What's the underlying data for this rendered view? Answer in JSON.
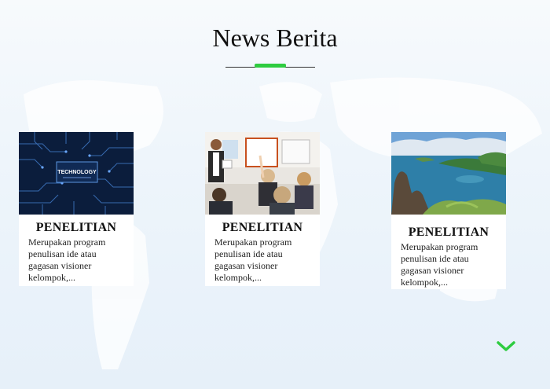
{
  "header": {
    "title": "News Berita"
  },
  "colors": {
    "accent": "#2ecc40",
    "background": "#eef5fb"
  },
  "cards": [
    {
      "label": "PENELITIAN",
      "description": "Merupakan program penulisan ide atau gagasan visioner kelompok,...",
      "image": "technology-circuit-image",
      "image_text": "TECHNOLOGY"
    },
    {
      "label": "PENELITIAN",
      "description": "Merupakan program penulisan ide atau gagasan visioner kelompok,...",
      "image": "classroom-image"
    },
    {
      "label": "PENELITIAN",
      "description": "Merupakan program penulisan ide atau gagasan visioner kelompok,...",
      "image": "island-landscape-image"
    }
  ],
  "nav": {
    "scroll_icon": "chevron-down-icon"
  }
}
